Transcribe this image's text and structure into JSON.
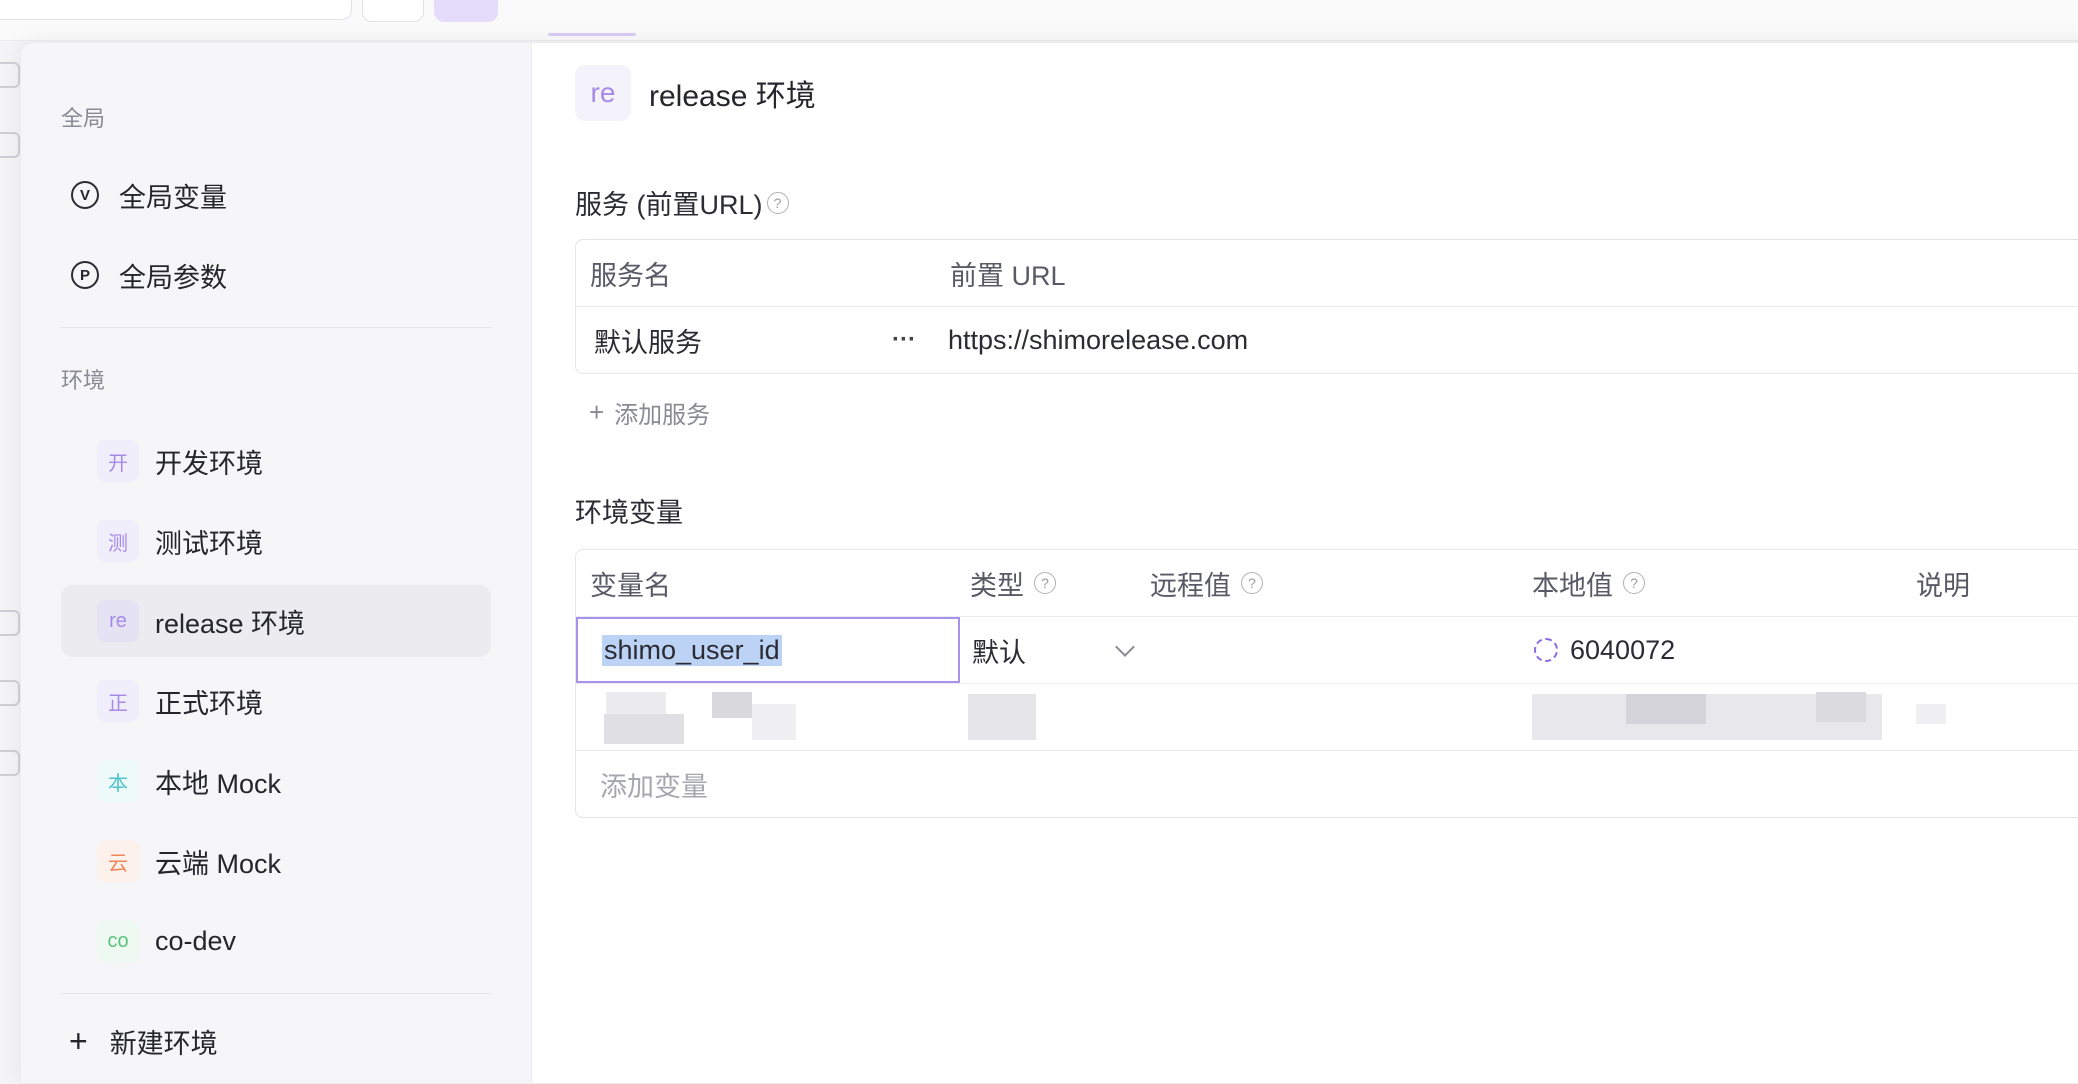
{
  "sidebar": {
    "global_section": "全局",
    "global_items": [
      {
        "icon": "v-circle-icon",
        "glyph": "V",
        "label": "全局变量"
      },
      {
        "icon": "p-circle-icon",
        "glyph": "P",
        "label": "全局参数"
      }
    ],
    "env_section": "环境",
    "environments": [
      {
        "badge": "开",
        "label": "开发环境",
        "badge_color": "#a58ae8",
        "badge_bg": "#f1eefb"
      },
      {
        "badge": "测",
        "label": "测试环境",
        "badge_color": "#a58ae8",
        "badge_bg": "#f1eefb"
      },
      {
        "badge": "re",
        "label": "release 环境",
        "badge_color": "#a58ae8",
        "badge_bg": "#e5e2f3",
        "active": true
      },
      {
        "badge": "正",
        "label": "正式环境",
        "badge_color": "#a58ae8",
        "badge_bg": "#f1eefb"
      },
      {
        "badge": "本",
        "label": "本地 Mock",
        "badge_color": "#4fc3c9",
        "badge_bg": "#eefafa"
      },
      {
        "badge": "云",
        "label": "云端 Mock",
        "badge_color": "#f0855a",
        "badge_bg": "#fdf1ec"
      },
      {
        "badge": "co",
        "label": "co-dev",
        "badge_color": "#5cc27a",
        "badge_bg": "#eef9f1"
      }
    ],
    "new_env_label": "新建环境"
  },
  "main": {
    "badge": "re",
    "title": "release 环境",
    "services_heading": "服务 (前置URL)",
    "services_columns": [
      "服务名",
      "前置 URL"
    ],
    "services": [
      {
        "name": "默认服务",
        "more": "···",
        "url": "https://shimorelease.com"
      }
    ],
    "add_service": "添加服务",
    "vars_heading": "环境变量",
    "vars_columns": [
      "变量名",
      "类型",
      "远程值",
      "本地值",
      "说明"
    ],
    "variables": [
      {
        "name": "shimo_user_id",
        "type": "默认",
        "remote": "",
        "local": "6040072",
        "desc": ""
      }
    ],
    "add_variable_placeholder": "添加变量"
  },
  "colors": {
    "accent": "#a892ee",
    "selection": "#bcd3f6"
  }
}
